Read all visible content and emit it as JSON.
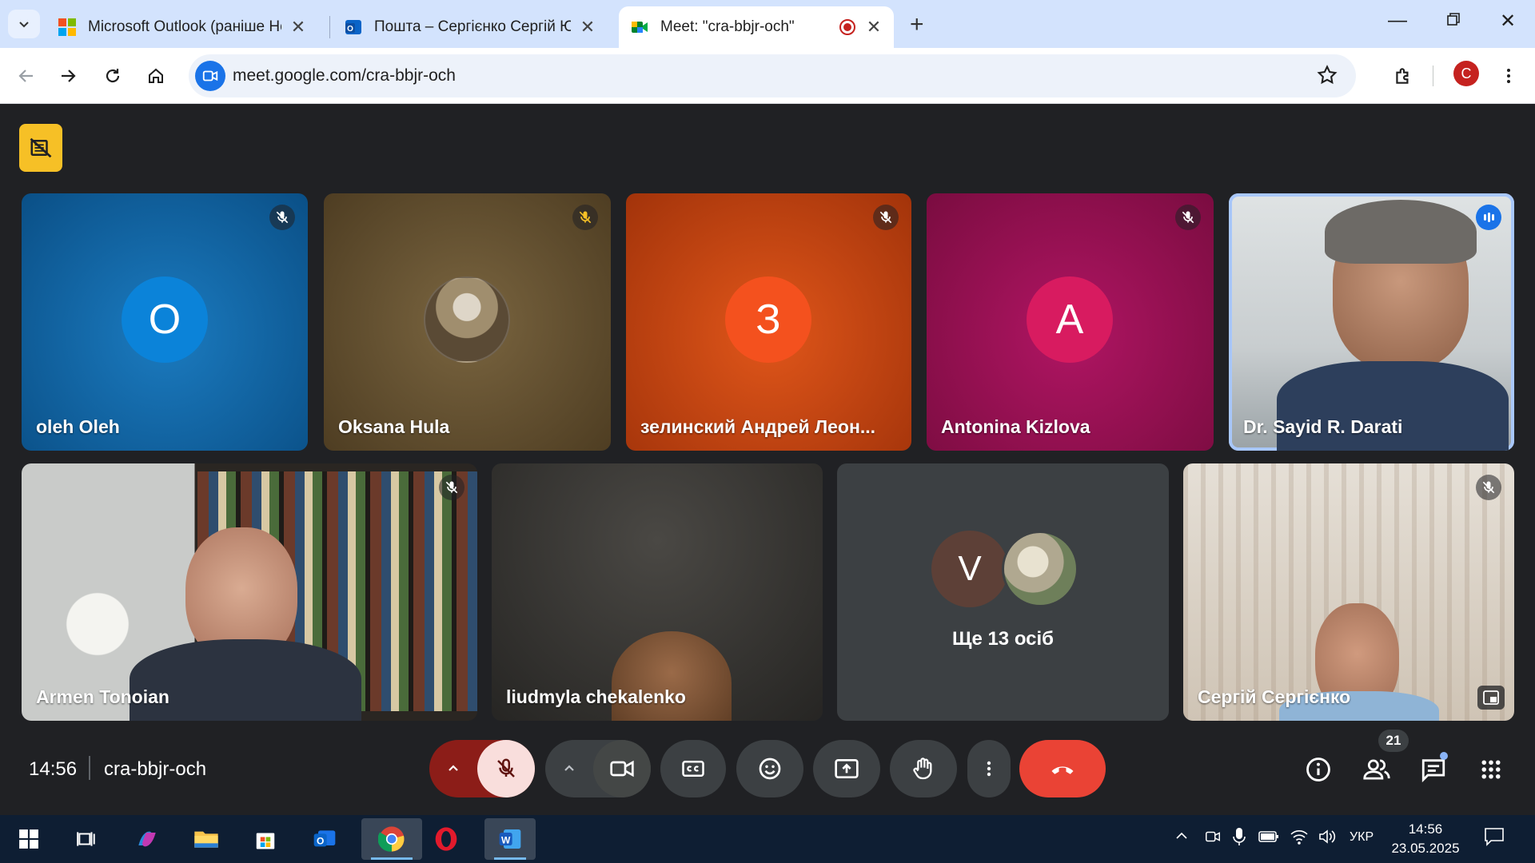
{
  "browser": {
    "tabs": [
      {
        "title": "Microsoft Outlook (раніше Hot"
      },
      {
        "title": "Пошта – Сергієнко Сергій Юр"
      },
      {
        "title": "Meet: \"cra-bbjr-och\""
      }
    ],
    "url": "meet.google.com/cra-bbjr-och",
    "profile_initial": "С"
  },
  "meet": {
    "tiles_row1": [
      {
        "name": "oleh Oleh",
        "initial": "O",
        "avatar_color": "#0b7ccf",
        "bg": "#0b5f9a"
      },
      {
        "name": "Oksana Hula",
        "initial": "",
        "avatar_color": "#8a7a5e",
        "bg": "#6e5a35"
      },
      {
        "name": "зелинский Андрей Леон...",
        "initial": "З",
        "avatar_color": "#f4511e",
        "bg": "#c2410c"
      },
      {
        "name": "Antonina Kizlova",
        "initial": "A",
        "avatar_color": "#d81b60",
        "bg": "#9c1050"
      },
      {
        "name": "Dr. Sayid R. Darati",
        "initial": "",
        "avatar_color": "#999",
        "bg": "#cfd4d6"
      }
    ],
    "tiles_row2": [
      {
        "name": "Armen Tonoian"
      },
      {
        "name": "liudmyla chekalenko"
      },
      {
        "name": "Ще 13 осіб",
        "initial": "V"
      },
      {
        "name": "Сергій Сергієнко"
      }
    ],
    "clock": "14:56",
    "meeting_code": "cra-bbjr-och",
    "participants_count": "21"
  },
  "taskbar": {
    "language": "УКР",
    "time": "14:56",
    "date": "23.05.2025"
  },
  "colors": {
    "accent_blue": "#1a73e8",
    "end_call_red": "#ea4335",
    "mic_off_bg": "#f9dedc",
    "rec_yellow": "#f6c026"
  }
}
